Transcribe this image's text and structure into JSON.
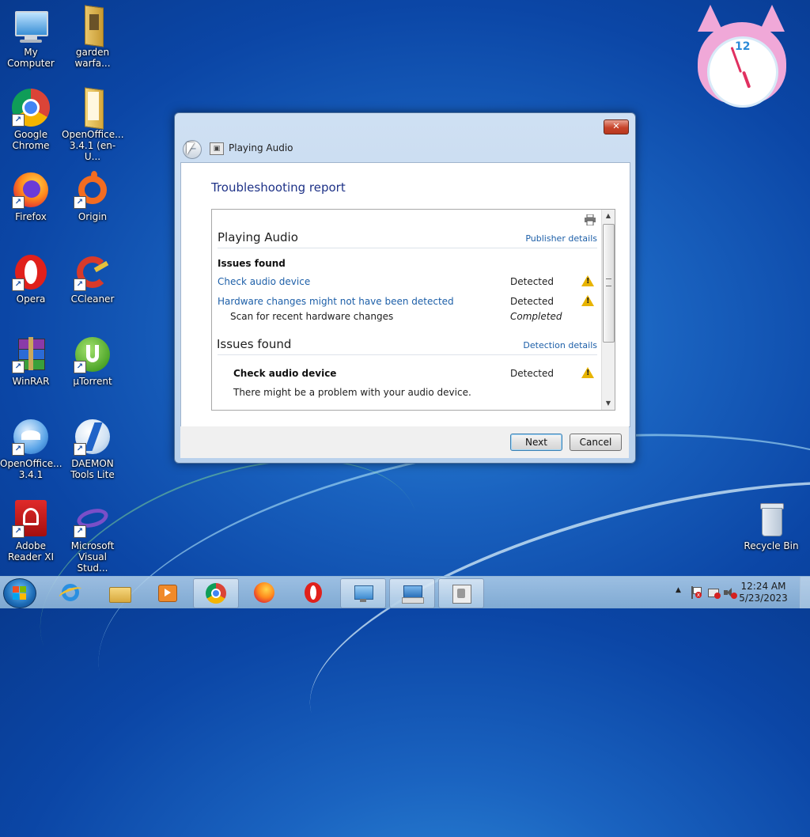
{
  "desktop": {
    "icons": [
      {
        "label": "My Computer"
      },
      {
        "label": "garden warfa..."
      },
      {
        "label": "Google Chrome"
      },
      {
        "label": "OpenOffice... 3.4.1 (en-U..."
      },
      {
        "label": "Firefox"
      },
      {
        "label": "Origin"
      },
      {
        "label": "Opera"
      },
      {
        "label": "CCleaner"
      },
      {
        "label": "WinRAR"
      },
      {
        "label": "µTorrent"
      },
      {
        "label": "OpenOffice... 3.4.1"
      },
      {
        "label": "DAEMON Tools Lite"
      },
      {
        "label": "Adobe Reader XI"
      },
      {
        "label": "Microsoft Visual Stud..."
      },
      {
        "label": "Recycle Bin"
      }
    ],
    "shortcut_glyph": "↗"
  },
  "gadget": {
    "clock_number": "12"
  },
  "dialog": {
    "window_title": "Playing Audio",
    "close_glyph": "✕",
    "back_glyph": "←",
    "heading": "Troubleshooting report",
    "report": {
      "section1_title": "Playing Audio",
      "section1_link": "Publisher details",
      "issues_found_label": "Issues found",
      "issue1_link": "Check audio device",
      "issue1_status": "Detected",
      "issue2_link": "Hardware changes might not have been detected",
      "issue2_status": "Detected",
      "issue2_sub": "Scan for recent hardware changes",
      "issue2_sub_status": "Completed",
      "section2_title": "Issues found",
      "section2_link": "Detection details",
      "detail_title": "Check audio device",
      "detail_status": "Detected",
      "detail_text": "There might be a problem with your audio device.",
      "warn_glyph": "!"
    },
    "buttons": {
      "next": "Next",
      "cancel": "Cancel"
    }
  },
  "taskbar": {
    "time": "12:24 AM",
    "date": "5/23/2023"
  },
  "colors": {
    "link": "#1d5fa8",
    "heading": "#1e3287",
    "warning": "#e8b400"
  }
}
